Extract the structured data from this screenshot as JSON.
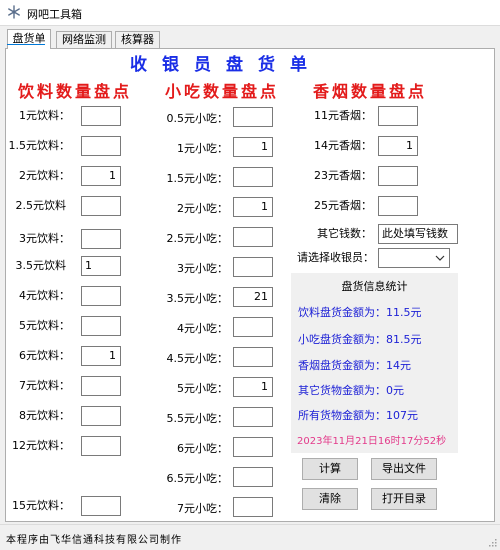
{
  "window": {
    "title": "网吧工具箱"
  },
  "tabs": [
    {
      "label": "盘货单",
      "active": true
    },
    {
      "label": "网络监测",
      "active": false
    },
    {
      "label": "核算器",
      "active": false
    }
  ],
  "form": {
    "title": "收银员盘货单",
    "drinks": {
      "heading": "饮料数量盘点",
      "items": [
        {
          "label": "1元饮料：",
          "value": ""
        },
        {
          "label": "1.5元饮料：",
          "value": ""
        },
        {
          "label": "2元饮料：",
          "value": "1"
        },
        {
          "label": "2.5元饮料",
          "value": ""
        },
        {
          "label": "3元饮料：",
          "value": ""
        },
        {
          "label": "3.5元饮料",
          "value": "1"
        },
        {
          "label": "4元饮料：",
          "value": ""
        },
        {
          "label": "5元饮料：",
          "value": ""
        },
        {
          "label": "6元饮料：",
          "value": "1"
        },
        {
          "label": "7元饮料：",
          "value": ""
        },
        {
          "label": "8元饮料：",
          "value": ""
        },
        {
          "label": "12元饮料：",
          "value": ""
        },
        {
          "label": "15元饮料：",
          "value": ""
        }
      ]
    },
    "snacks": {
      "heading": "小吃数量盘点",
      "items": [
        {
          "label": "0.5元小吃：",
          "value": ""
        },
        {
          "label": "1元小吃：",
          "value": "1"
        },
        {
          "label": "1.5元小吃：",
          "value": ""
        },
        {
          "label": "2元小吃：",
          "value": "1"
        },
        {
          "label": "2.5元小吃：",
          "value": ""
        },
        {
          "label": "3元小吃：",
          "value": ""
        },
        {
          "label": "3.5元小吃：",
          "value": "21"
        },
        {
          "label": "4元小吃：",
          "value": ""
        },
        {
          "label": "4.5元小吃：",
          "value": ""
        },
        {
          "label": "5元小吃：",
          "value": "1"
        },
        {
          "label": "5.5元小吃：",
          "value": ""
        },
        {
          "label": "6元小吃：",
          "value": ""
        },
        {
          "label": "6.5元小吃：",
          "value": ""
        },
        {
          "label": "7元小吃：",
          "value": ""
        }
      ]
    },
    "cigs": {
      "heading": "香烟数量盘点",
      "items": [
        {
          "label": "11元香烟：",
          "value": ""
        },
        {
          "label": "14元香烟：",
          "value": "1"
        },
        {
          "label": "23元香烟：",
          "value": ""
        },
        {
          "label": "25元香烟：",
          "value": ""
        }
      ]
    },
    "other": {
      "label": "其它钱数：",
      "value": "此处填写钱数"
    },
    "cashier": {
      "label": "请选择收银员：",
      "value": ""
    }
  },
  "stats": {
    "title": "盘货信息统计",
    "lines": [
      "饮料盘货金额为：11.5元",
      "小吃盘货金额为：81.5元",
      "香烟盘货金额为：14元",
      "其它货物金额为：0元",
      "所有货物金额为：107元"
    ],
    "timestamp": "2023年11月21日16时17分52秒"
  },
  "buttons": {
    "calc": "计算",
    "export": "导出文件",
    "clear": "清除",
    "open_dir": "打开目录"
  },
  "statusbar": {
    "text": "本程序由飞华信通科技有限公司制作"
  },
  "colors": {
    "title": "#1a2ee6",
    "heading": "#e31b1b",
    "stats_text": "#1e22d6",
    "timestamp": "#e33a8a"
  }
}
